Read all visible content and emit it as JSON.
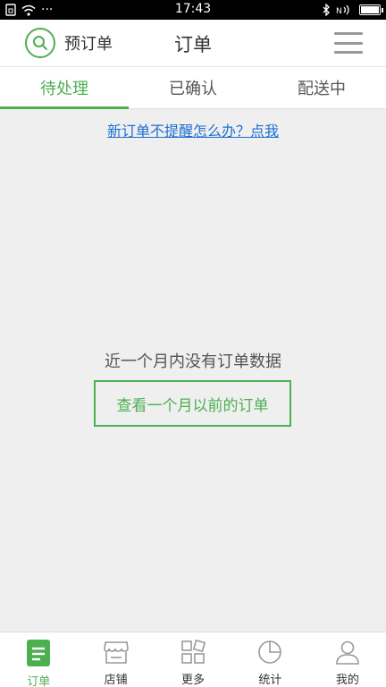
{
  "status_bar": {
    "time": "17:43",
    "more": "···"
  },
  "header": {
    "pre_order_label": "预订单",
    "title": "订单"
  },
  "tabs": [
    {
      "label": "待处理",
      "active": true
    },
    {
      "label": "已确认",
      "active": false
    },
    {
      "label": "配送中",
      "active": false
    }
  ],
  "reminder_link": "新订单不提醒怎么办？点我",
  "empty_state": {
    "message": "近一个月内没有订单数据",
    "button_label": "查看一个月以前的订单"
  },
  "bottom_nav": [
    {
      "label": "订单",
      "icon": "order-icon",
      "active": true
    },
    {
      "label": "店铺",
      "icon": "store-icon",
      "active": false
    },
    {
      "label": "更多",
      "icon": "more-grid-icon",
      "active": false
    },
    {
      "label": "统计",
      "icon": "pie-chart-icon",
      "active": false
    },
    {
      "label": "我的",
      "icon": "user-icon",
      "active": false
    }
  ],
  "colors": {
    "accent": "#4cb051",
    "link": "#1c6fd1",
    "background": "#efefef"
  }
}
